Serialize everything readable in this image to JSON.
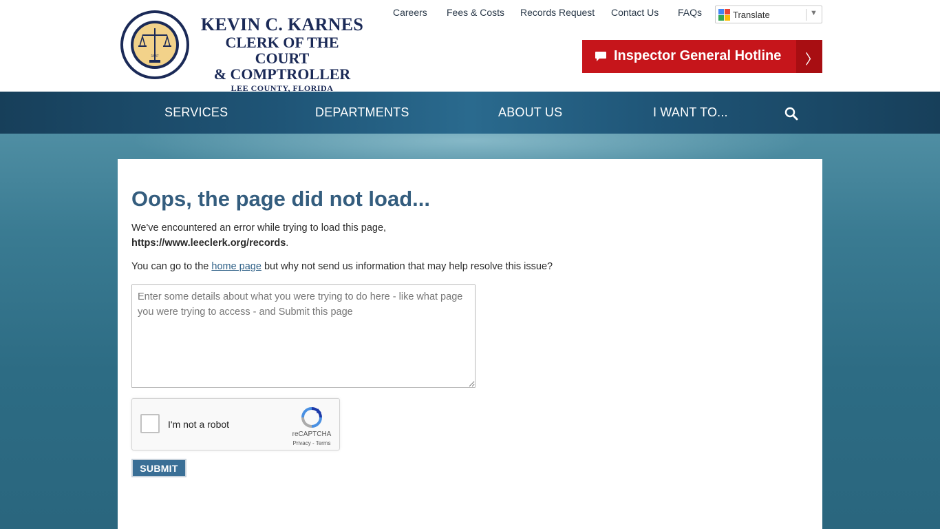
{
  "logo": {
    "name": "KEVIN C. KARNES",
    "line2": "CLERK OF THE COURT",
    "line3": "& COMPTROLLER",
    "county": "LEE COUNTY, FLORIDA",
    "seal_year": "1887"
  },
  "top_links": [
    "Careers",
    "Fees & Costs",
    "Records Request",
    "Contact Us",
    "FAQs"
  ],
  "translate": {
    "label": "Translate"
  },
  "hotline": {
    "label": "Inspector General Hotline",
    "arrow": "〉"
  },
  "nav": {
    "items": [
      "SERVICES",
      "DEPARTMENTS",
      "ABOUT US",
      "I WANT TO..."
    ]
  },
  "content": {
    "title": "Oops, the page did not load...",
    "para1_text": "We've encountered an error while trying to load this page,",
    "para1_url": "https://www.leeclerk.org/records",
    "para1_end": ".",
    "para2_before": "You can go to the ",
    "para2_link": "home page",
    "para2_after": " but why not send us information that may help resolve this issue?",
    "textarea_placeholder": "Enter some details about what you were trying to do here - like what page you were trying to access - and Submit this page",
    "submit_label": "SUBMIT"
  },
  "captcha": {
    "label": "I'm not a robot",
    "brand": "reCAPTCHA",
    "terms": "Privacy - Terms"
  },
  "colors": {
    "brand_navy": "#1b2a57",
    "hotline_red": "#c6151b",
    "title_blue": "#345d7e",
    "nav_blue": "#1f5577"
  }
}
